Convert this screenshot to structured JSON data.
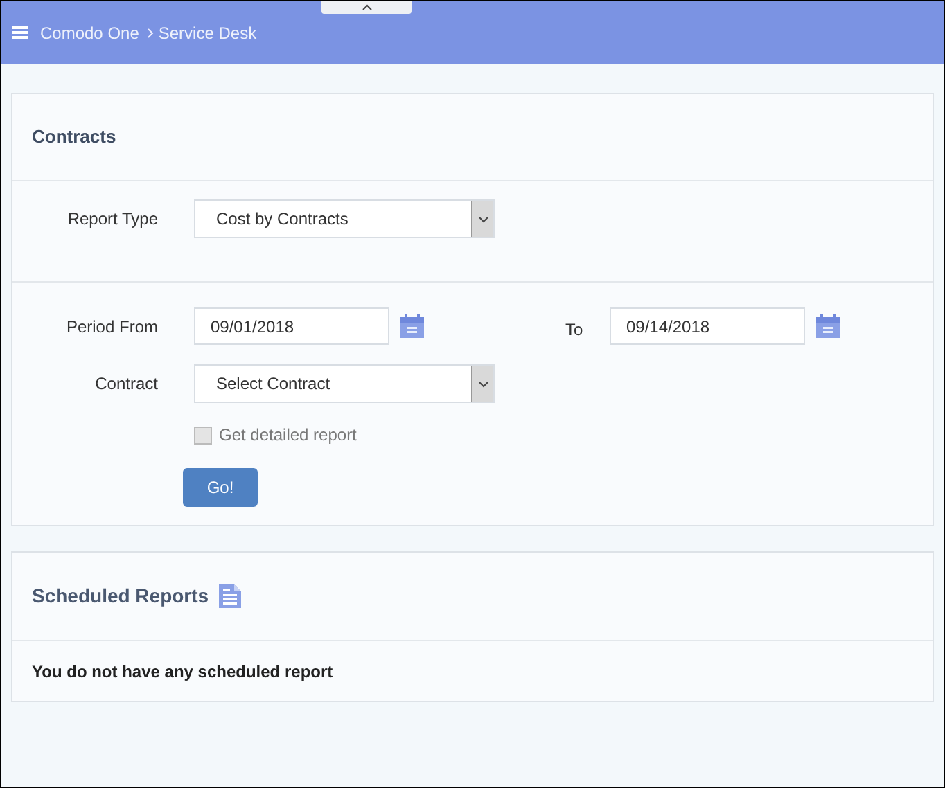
{
  "breadcrumb": [
    "Comodo One",
    "Service Desk"
  ],
  "contracts": {
    "title": "Contracts",
    "report_type": {
      "label": "Report Type",
      "value": "Cost by Contracts"
    },
    "period_from": {
      "label": "Period From",
      "value": "09/01/2018"
    },
    "period_to": {
      "label": "To",
      "value": "09/14/2018"
    },
    "contract": {
      "label": "Contract",
      "value": "Select Contract"
    },
    "detailed": {
      "label": "Get detailed report",
      "checked": false,
      "disabled": true
    },
    "go_button": "Go!"
  },
  "scheduled": {
    "title": "Scheduled Reports",
    "message": "You do not have any scheduled report"
  }
}
